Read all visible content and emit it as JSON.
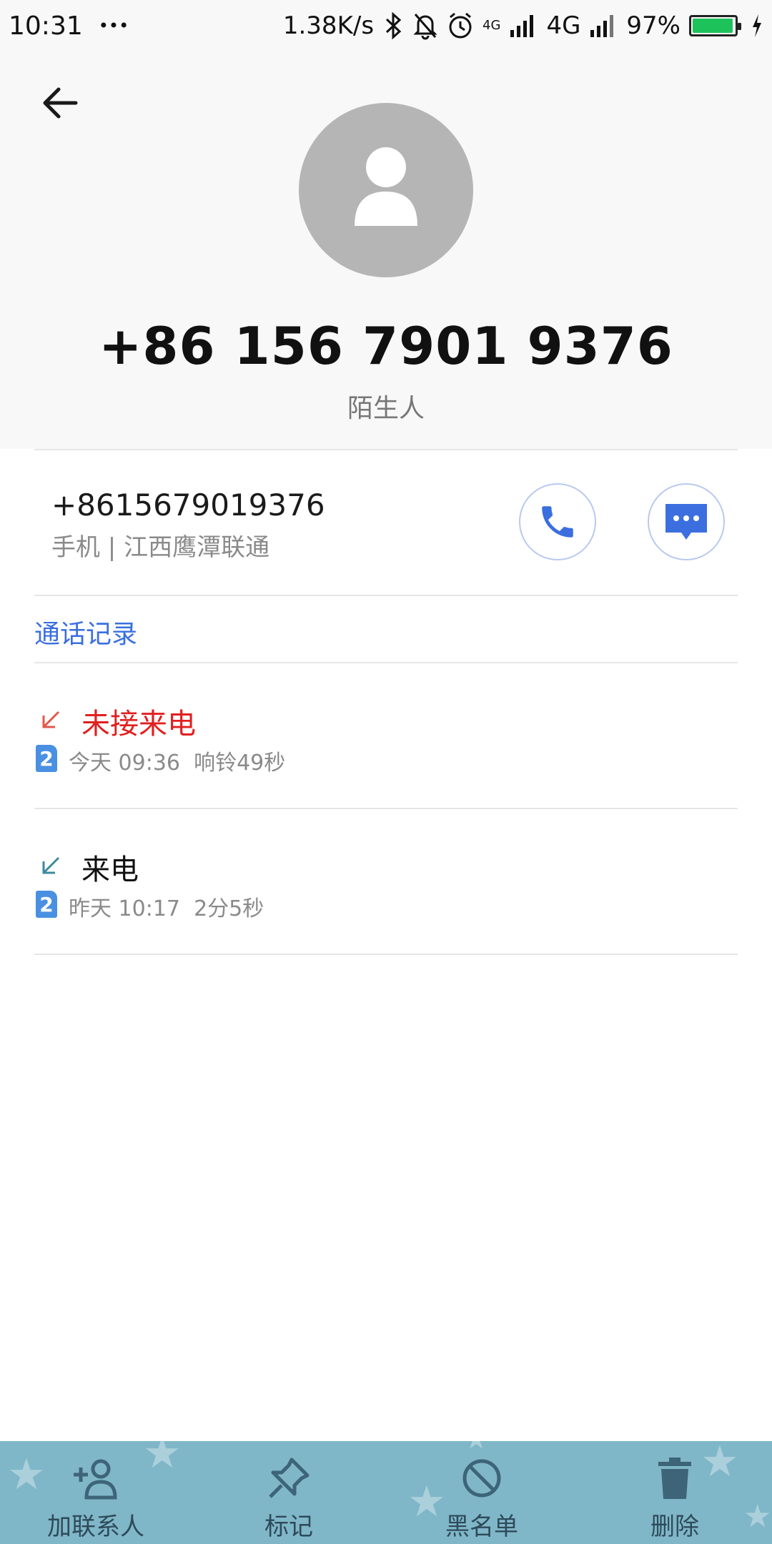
{
  "status_bar": {
    "time": "10:31",
    "more": "•••",
    "speed": "1.38K/s",
    "network_small": "4G",
    "network": "4G",
    "battery_text": "97%",
    "battery_level": 0.97,
    "icons": [
      "bluetooth-icon",
      "mute-bell-icon",
      "alarm-icon",
      "signal-icon",
      "battery-icon",
      "charging-icon"
    ]
  },
  "header": {
    "phone_title": "+86 156 7901 9376",
    "tag": "陌生人"
  },
  "number_row": {
    "number": "+8615679019376",
    "detail": "手机 | 江西鹰潭联通"
  },
  "call_log": {
    "section_label": "通话记录",
    "items": [
      {
        "type": "未接来电",
        "sim": "2",
        "time": "今天 09:36",
        "duration": "响铃49秒",
        "missed": true
      },
      {
        "type": "来电",
        "sim": "2",
        "time": "昨天 10:17",
        "duration": "2分5秒",
        "missed": false
      }
    ]
  },
  "bottom_bar": {
    "add_contact": "加联系人",
    "mark": "标记",
    "blacklist": "黑名单",
    "delete": "删除"
  },
  "colors": {
    "accent": "#3b6fe0",
    "missed": "#e02020",
    "bottom_bar": "#7fb7c8",
    "battery": "#1ec25a"
  }
}
